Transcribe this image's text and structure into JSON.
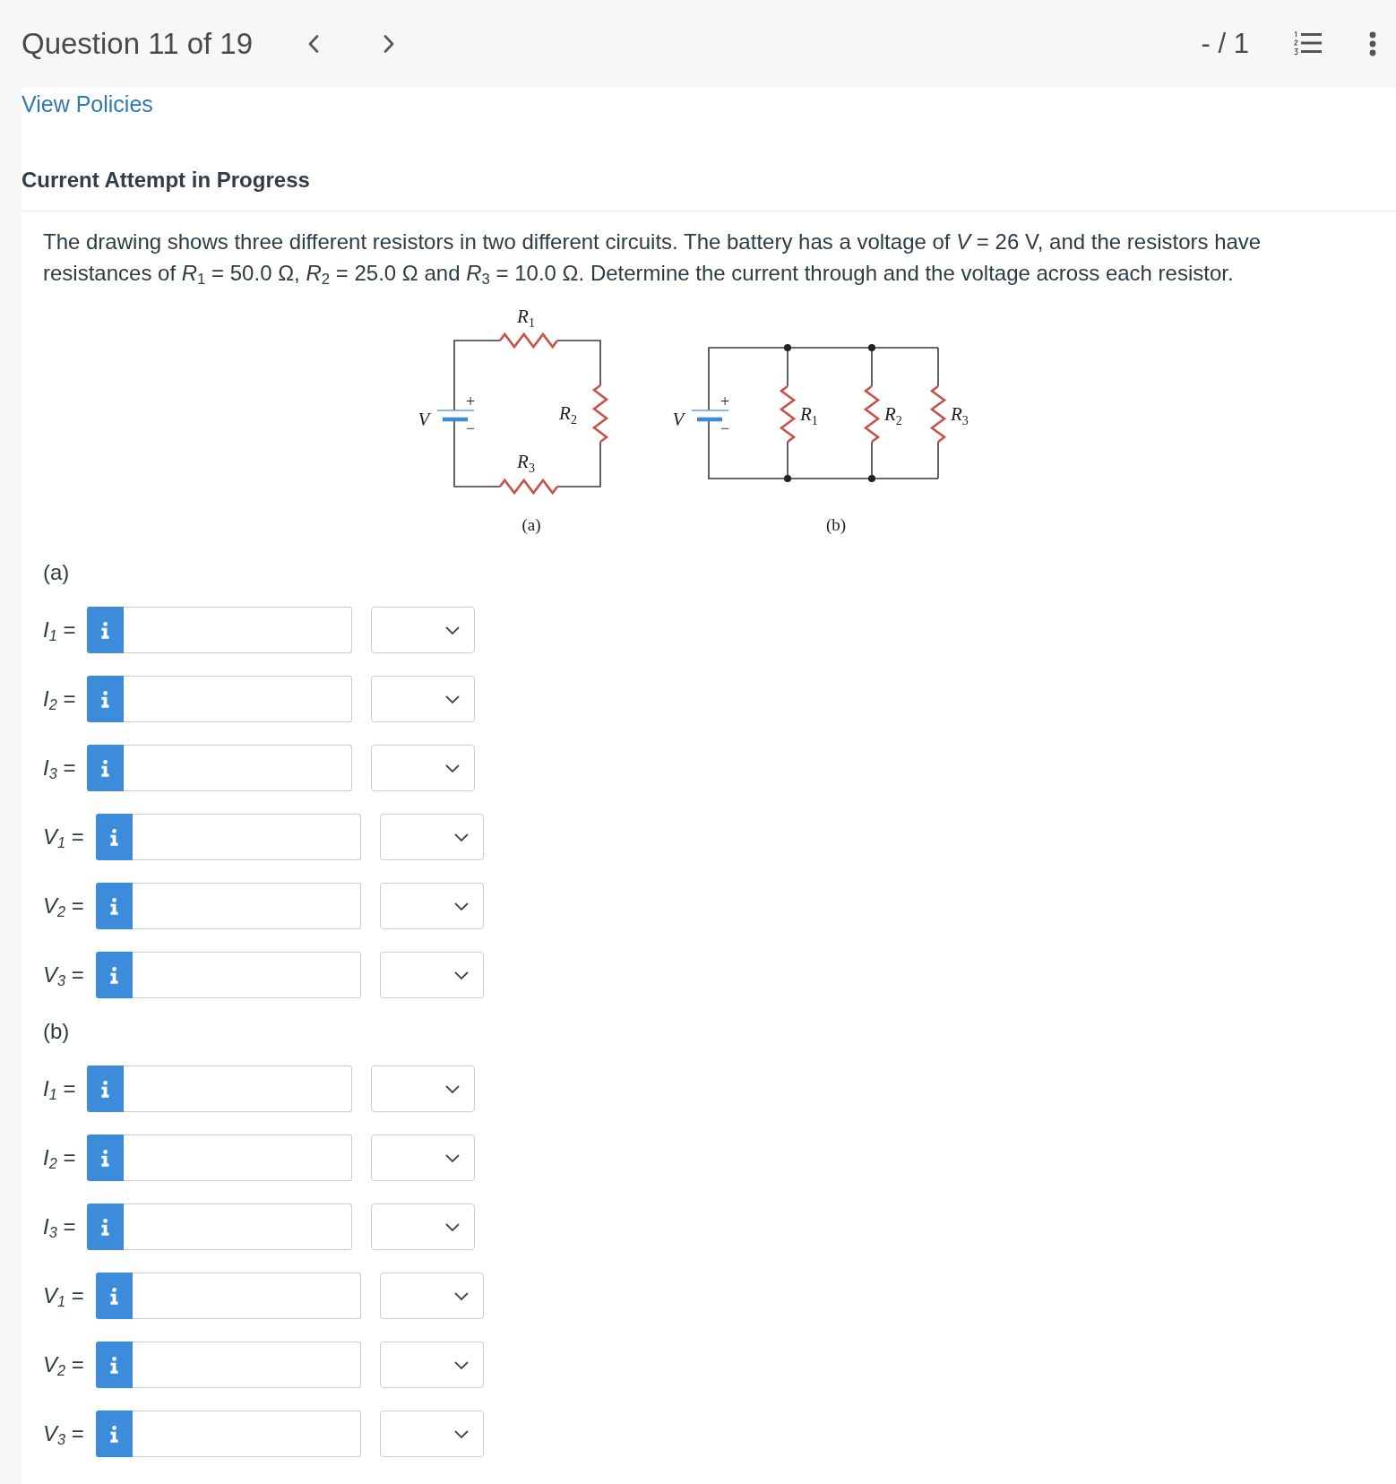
{
  "header": {
    "title": "Question 11 of 19",
    "score": "- / 1"
  },
  "policies_link": "View Policies",
  "attempt_heading": "Current Attempt in Progress",
  "question": {
    "text": "The drawing shows three different resistors in two different circuits. The battery has a voltage of *V* = 26 V, and the resistors have resistances of *R*$_{1}$ = 50.0 Ω, *R*$_{2}$ = 25.0 Ω and *R*$_{3}$ = 10.0 Ω. Determine the current through and the voltage across each resistor."
  },
  "figure": {
    "circuits": [
      {
        "kind": "series",
        "caption": "(a)",
        "battery": {
          "symbol": "V",
          "positive": "+",
          "negative": "−"
        },
        "resistors": [
          {
            "symbol": "R",
            "index": "1"
          },
          {
            "symbol": "R",
            "index": "2"
          },
          {
            "symbol": "R",
            "index": "3"
          }
        ]
      },
      {
        "kind": "parallel",
        "caption": "(b)",
        "battery": {
          "symbol": "V",
          "positive": "+",
          "negative": "−"
        },
        "resistors": [
          {
            "symbol": "R",
            "index": "1"
          },
          {
            "symbol": "R",
            "index": "2"
          },
          {
            "symbol": "R",
            "index": "3"
          }
        ]
      }
    ]
  },
  "parts": [
    {
      "label": "(a)",
      "answers": [
        {
          "variable": "I",
          "index": "1",
          "relation": "="
        },
        {
          "variable": "I",
          "index": "2",
          "relation": "="
        },
        {
          "variable": "I",
          "index": "3",
          "relation": "="
        },
        {
          "variable": "V",
          "index": "1",
          "relation": "="
        },
        {
          "variable": "V",
          "index": "2",
          "relation": "="
        },
        {
          "variable": "V",
          "index": "3",
          "relation": "="
        }
      ]
    },
    {
      "label": "(b)",
      "answers": [
        {
          "variable": "I",
          "index": "1",
          "relation": "="
        },
        {
          "variable": "I",
          "index": "2",
          "relation": "="
        },
        {
          "variable": "I",
          "index": "3",
          "relation": "="
        },
        {
          "variable": "V",
          "index": "1",
          "relation": "="
        },
        {
          "variable": "V",
          "index": "2",
          "relation": "="
        },
        {
          "variable": "V",
          "index": "3",
          "relation": "="
        }
      ]
    }
  ]
}
